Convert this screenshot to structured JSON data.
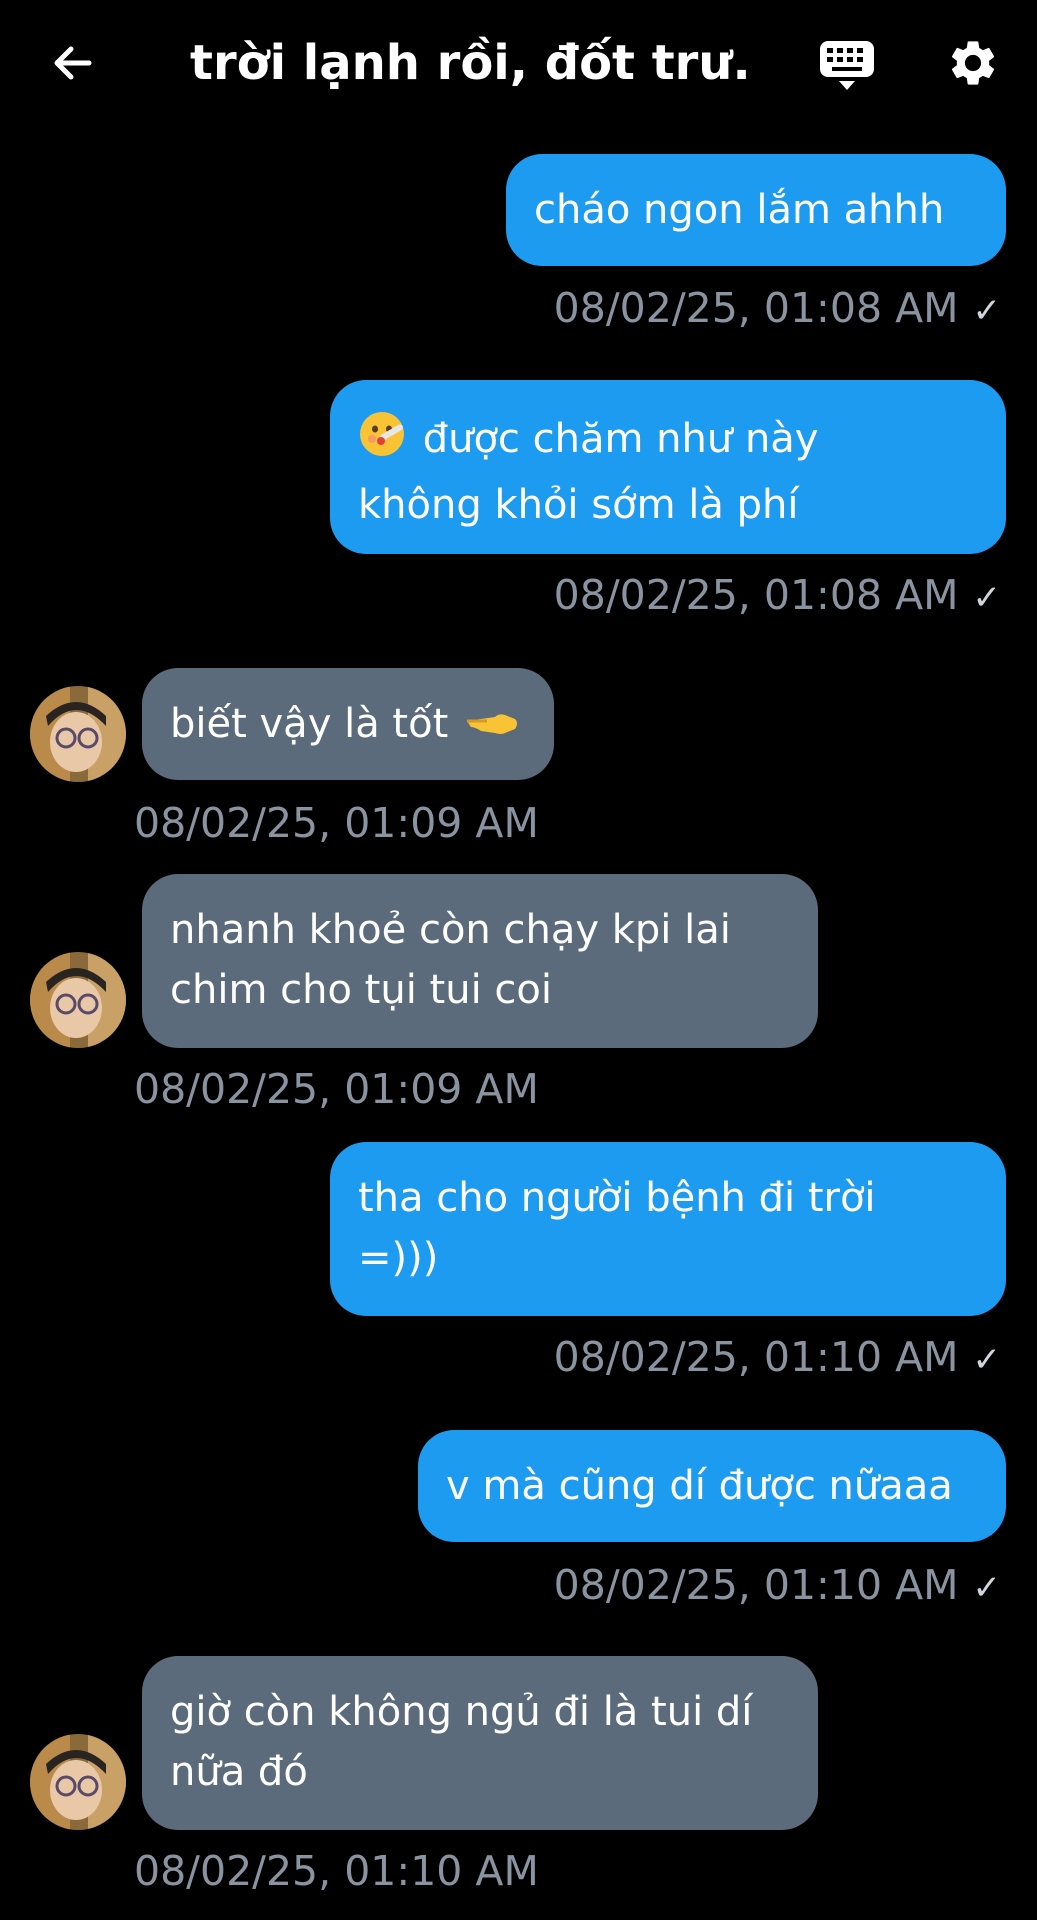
{
  "header": {
    "title": "trời lạnh rồi, đốt trư..."
  },
  "colors": {
    "outgoing_bubble": "#1d9bf0",
    "incoming_bubble": "#5b6b7c",
    "timestamp": "#8a93a0",
    "background": "#000000"
  },
  "messages": [
    {
      "direction": "outgoing",
      "text": "cháo ngon lắm ahhh",
      "timestamp": "08/02/25, 01:08 AM",
      "read_mark": "✓"
    },
    {
      "direction": "outgoing",
      "emoji": "face-with-thermometer",
      "text_line1": "được chăm như này",
      "text_line2": "không khỏi sớm là phí",
      "timestamp": "08/02/25, 01:08 AM",
      "read_mark": "✓"
    },
    {
      "direction": "incoming",
      "text": "biết vậy là tốt",
      "emoji": "backhand-index-pointing-left",
      "timestamp": "08/02/25, 01:09 AM"
    },
    {
      "direction": "incoming",
      "text_line1": "nhanh khoẻ còn chạy kpi lai",
      "text_line2": "chim cho tụi tui coi",
      "timestamp": "08/02/25, 01:09 AM"
    },
    {
      "direction": "outgoing",
      "text_line1": "tha cho người bệnh đi trời",
      "text_line2": "=)))",
      "timestamp": "08/02/25, 01:10 AM",
      "read_mark": "✓"
    },
    {
      "direction": "outgoing",
      "text": "v mà cũng dí được nữaaa",
      "timestamp": "08/02/25, 01:10 AM",
      "read_mark": "✓"
    },
    {
      "direction": "incoming",
      "text_line1": "giờ còn không ngủ đi là tui dí",
      "text_line2": "nữa đó",
      "timestamp": "08/02/25, 01:10 AM"
    }
  ],
  "icons": [
    "back-arrow-icon",
    "keyboard-icon",
    "gear-icon",
    "avatar"
  ]
}
